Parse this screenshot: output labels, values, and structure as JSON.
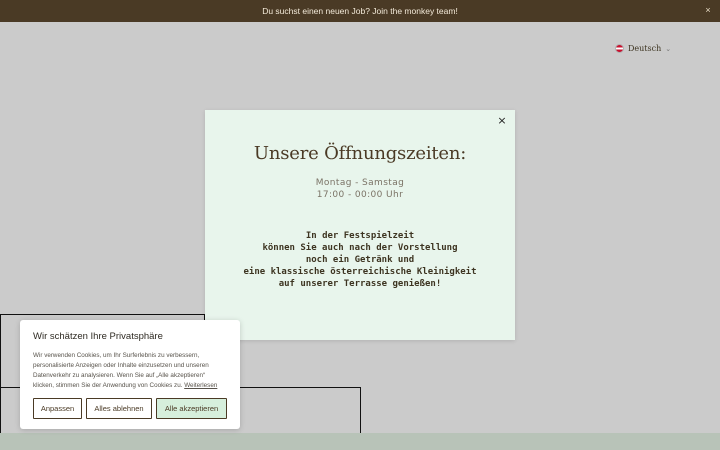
{
  "announcement": {
    "text": "Du suchst einen neuen Job? Join the monkey team!",
    "close_glyph": "×"
  },
  "language": {
    "label": "Deutsch",
    "flag": "austria-flag",
    "chevron": "⌄"
  },
  "modal": {
    "close_glyph": "×",
    "title": "Unsere Öffnungszeiten:",
    "days": "Montag - Samstag",
    "hours": "17:00 - 00:00 Uhr",
    "lines": [
      "In der Festspielzeit",
      "können Sie auch nach der Vorstellung",
      "noch ein Getränk und",
      "eine klassische österreichische Kleinigkeit",
      "auf unserer Terrasse genießen!"
    ]
  },
  "cookie": {
    "title": "Wir schätzen Ihre Privatsphäre",
    "body": "Wir verwenden Cookies, um Ihr Surferlebnis zu verbessern, personalisierte Anzeigen oder Inhalte einzusetzen und unseren Datenverkehr zu analysieren. Wenn Sie auf „Alle akzeptieren“ klicken, stimmen Sie der Anwendung von Cookies zu.",
    "link": "Weiterlesen",
    "buttons": {
      "customize": "Anpassen",
      "reject": "Alles ablehnen",
      "accept": "Alle akzeptieren"
    }
  },
  "colors": {
    "announcement_bg": "#4a3a25",
    "page_bg": "#cbcbcb",
    "modal_bg": "#e8f5ec",
    "accept_bg": "#d6efdc",
    "bottom_strip": "#b8c3b8"
  }
}
